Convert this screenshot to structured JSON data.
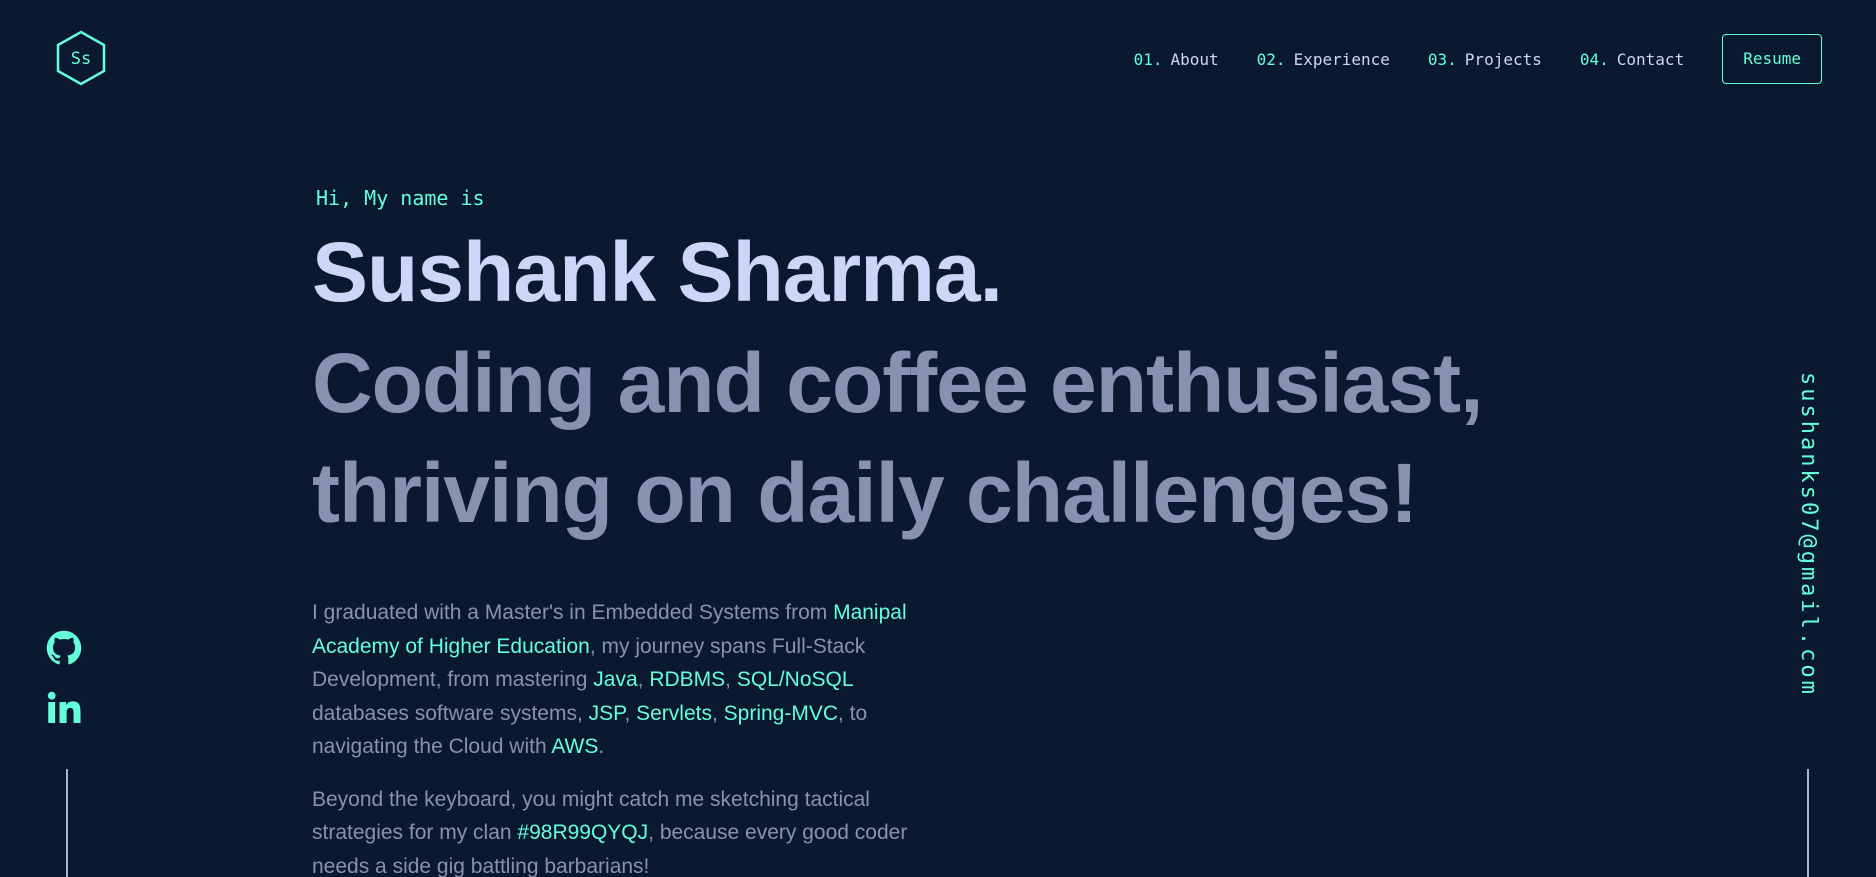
{
  "logo": {
    "text": "Ss",
    "icon": "hexagon-logo-icon"
  },
  "nav": {
    "items": [
      {
        "num": "01.",
        "label": "About"
      },
      {
        "num": "02.",
        "label": "Experience"
      },
      {
        "num": "03.",
        "label": "Projects"
      },
      {
        "num": "04.",
        "label": "Contact"
      }
    ],
    "resume_label": "Resume"
  },
  "hero": {
    "greeting": "Hi, My name is",
    "name": "Sushank Sharma.",
    "tagline_line1": "Coding and coffee enthusiast,",
    "tagline_line2": "thriving on daily challenges!",
    "bio1": {
      "t1": "I graduated with a Master's in Embedded Systems from ",
      "h1": "Manipal Academy of Higher Education",
      "t2": ", my journey spans Full-Stack Development, from mastering ",
      "h2": "Java",
      "t3": ", ",
      "h3": "RDBMS",
      "t4": ", ",
      "h4": "SQL/NoSQL",
      "t5": " databases software systems, ",
      "h5": "JSP",
      "t6": ", ",
      "h6": "Servlets",
      "t7": ", ",
      "h7": "Spring-MVC",
      "t8": ", to navigating the Cloud with ",
      "h8": "AWS",
      "t9": "."
    },
    "bio2": {
      "t1": "Beyond the keyboard, you might catch me sketching tactical strategies for my clan ",
      "h1": "#98R99QYQJ",
      "t2": ", because every good coder needs a side gig battling barbarians!"
    }
  },
  "social": {
    "icons": [
      "github-icon",
      "linkedin-icon"
    ]
  },
  "email": "sushanks07@gmail.com",
  "colors": {
    "background": "#0a192f",
    "accent": "#64ffda",
    "heading": "#ccd6f6",
    "body_text": "#8892b0"
  }
}
